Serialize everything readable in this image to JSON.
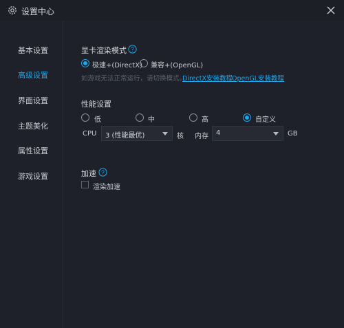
{
  "window": {
    "title": "设置中心",
    "icons": {
      "settings": "gear-icon",
      "close": "close-icon"
    }
  },
  "sidebar": {
    "items": [
      {
        "label": "基本设置",
        "active": false
      },
      {
        "label": "高级设置",
        "active": true
      },
      {
        "label": "界面设置",
        "active": false
      },
      {
        "label": "主题美化",
        "active": false
      },
      {
        "label": "属性设置",
        "active": false
      },
      {
        "label": "游戏设置",
        "active": false
      }
    ]
  },
  "render": {
    "title": "显卡渲染模式",
    "options": [
      {
        "label": "极速+(DirectX)",
        "selected": true
      },
      {
        "label": "兼容+(OpenGL)",
        "selected": false
      }
    ],
    "hint": "如游戏无法正常运行，请切换模式。",
    "link_directx": "DirectX安装教程",
    "link_opengl": "OpenGL安装教程"
  },
  "performance": {
    "title": "性能设置",
    "options": [
      {
        "label": "低",
        "selected": false
      },
      {
        "label": "中",
        "selected": false
      },
      {
        "label": "高",
        "selected": false
      },
      {
        "label": "自定义",
        "selected": true
      }
    ],
    "cpu_label": "CPU",
    "cpu_value": "3 (性能最优)",
    "cpu_unit": "核",
    "memory_label": "内存",
    "memory_value": "4",
    "memory_unit": "GB"
  },
  "acceleration": {
    "title": "加速",
    "checkbox_label": "渲染加速",
    "checked": false
  },
  "colors": {
    "accent": "#1da7ee",
    "background": "#1e2129",
    "text": "#c9ccd3"
  }
}
